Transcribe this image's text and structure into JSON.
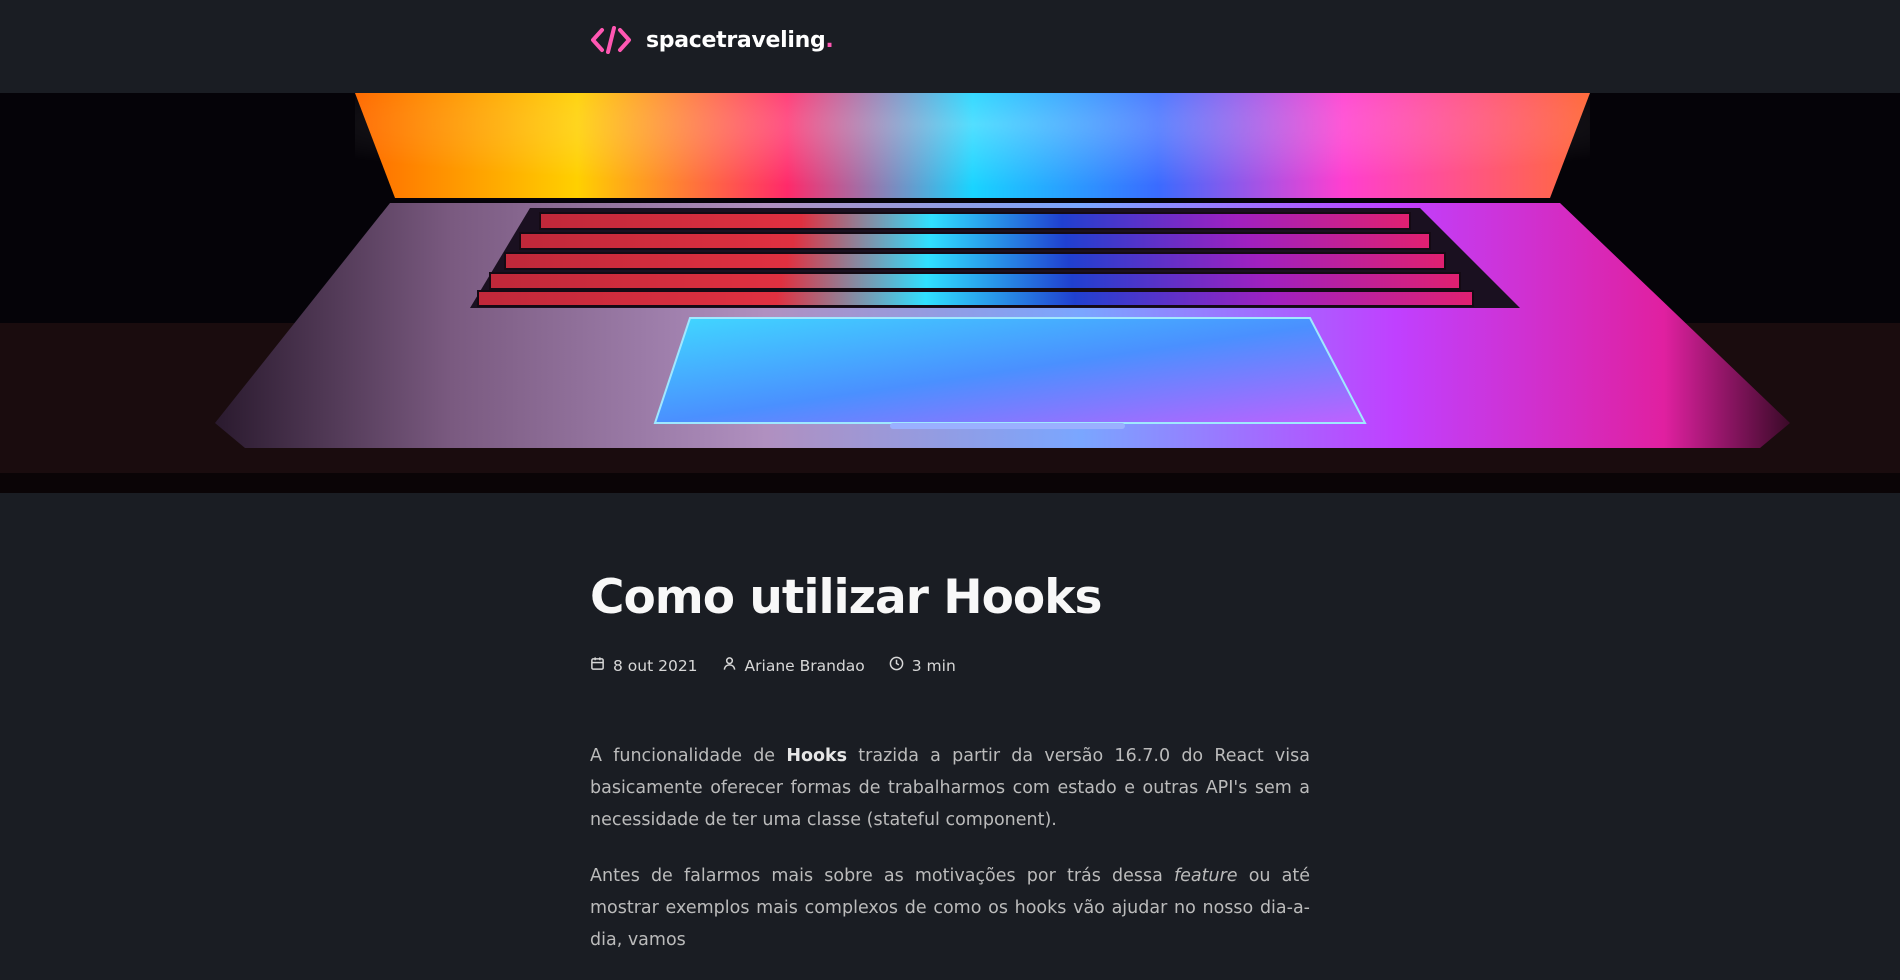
{
  "header": {
    "logo_text": "spacetraveling",
    "logo_dot": ".",
    "logo_icon": "code-brackets-icon"
  },
  "banner": {
    "image": "laptop-keyboard-colorful-banner"
  },
  "post": {
    "title": "Como utilizar Hooks",
    "date": "8 out 2021",
    "author": "Ariane Brandao",
    "reading_time": "3 min",
    "icons": {
      "date": "calendar-icon",
      "author": "user-icon",
      "reading_time": "clock-icon"
    },
    "p1": {
      "before": "A funcionalidade de ",
      "bold": "Hooks",
      "after": " trazida a partir da versão 16.7.0 do React visa basicamente oferecer formas de trabalharmos com estado e outras API's sem a necessidade de ter uma classe (stateful component)."
    },
    "p2": {
      "before": "Antes de falarmos mais sobre as motivações por trás dessa ",
      "italic": "feature",
      "after": " ou até mostrar exemplos mais complexos de como os hooks vão ajudar no nosso dia-a-dia, vamos"
    }
  },
  "colors": {
    "background": "#1a1d23",
    "accent": "#ff57b2",
    "title": "#f8f8f8",
    "body_text": "#bbbbbb"
  }
}
